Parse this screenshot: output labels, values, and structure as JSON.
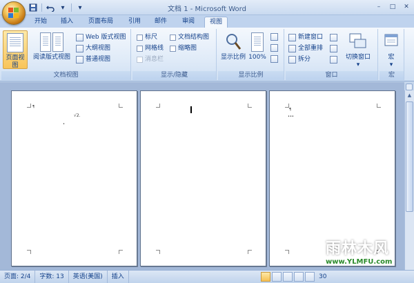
{
  "window": {
    "title": "文档 1 - Microsoft Word",
    "controls": [
      "–",
      "□",
      "✕"
    ]
  },
  "qat": {
    "save_icon": "save-icon",
    "undo_icon": "undo-icon",
    "customize": "▾"
  },
  "tabs": [
    {
      "label": "开始"
    },
    {
      "label": "插入"
    },
    {
      "label": "页面布局"
    },
    {
      "label": "引用"
    },
    {
      "label": "邮件"
    },
    {
      "label": "审阅"
    },
    {
      "label": "视图"
    }
  ],
  "active_tab": "视图",
  "groups": {
    "doc_views": {
      "label": "文档视图",
      "page_view": "页面视图",
      "reading_view": "阅读版式视图",
      "web_view": "Web 版式视图",
      "outline_view": "大纲视图",
      "draft_view": "普通视图"
    },
    "show_hide": {
      "label": "显示/隐藏",
      "ruler": "标尺",
      "gridlines": "网格线",
      "message_bar": "消息栏",
      "doc_map": "文档结构图",
      "thumbnails": "缩略图"
    },
    "zoom": {
      "label": "显示比例",
      "zoom_btn": "显示比例",
      "hundred": "100%"
    },
    "window": {
      "label": "窗口",
      "new_window": "新建窗口",
      "arrange_all": "全部重排",
      "split": "拆分",
      "switch_windows": "切换窗口"
    },
    "macros": {
      "label": "宏",
      "macros_btn": "宏"
    }
  },
  "pages": [
    {
      "marks": [
        "¶",
        "√2.",
        "•"
      ]
    },
    {
      "marks": []
    },
    {
      "marks": [
        "¶",
        "•••"
      ]
    }
  ],
  "status": {
    "page": "页面: 2/4",
    "words": "字数: 13",
    "language": "英语(美国)",
    "mode": "插入",
    "zoom": "30"
  },
  "watermark": {
    "text": "雨林木风",
    "url": "www.YLMFU.com"
  }
}
